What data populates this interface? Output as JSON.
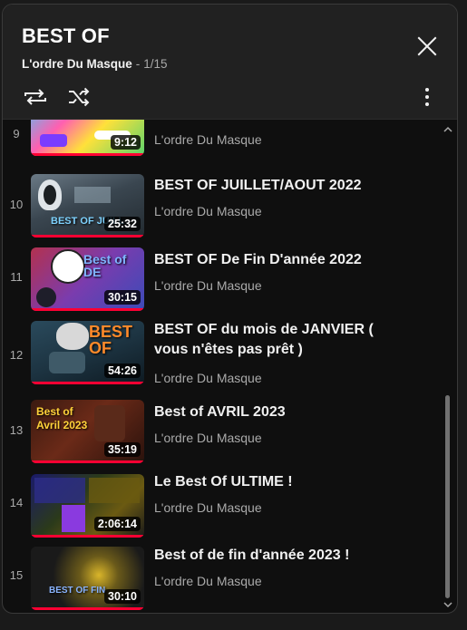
{
  "header": {
    "title": "BEST OF",
    "channel": "L'ordre Du Masque",
    "separator": "-",
    "position": "1/15"
  },
  "icons": {
    "close": "close-icon",
    "loop": "loop-icon",
    "shuffle": "shuffle-icon",
    "more": "more-vert-icon"
  },
  "colors": {
    "progress": "#ff0033",
    "background": "#0f0f0f",
    "header_bg": "#212121"
  },
  "items": [
    {
      "index": "9",
      "title": "",
      "channel": "L'ordre Du Masque",
      "duration": "9:12",
      "thumb_text": ""
    },
    {
      "index": "10",
      "title": "BEST OF JUILLET/AOUT 2022",
      "channel": "L'ordre Du Masque",
      "duration": "25:32",
      "thumb_text": "BEST OF JUILL"
    },
    {
      "index": "11",
      "title": "BEST OF De Fin D'année 2022",
      "channel": "L'ordre Du Masque",
      "duration": "30:15",
      "thumb_text": "Best of DE"
    },
    {
      "index": "12",
      "title": "BEST OF du mois de JANVIER ( vous n'êtes pas prêt )",
      "channel": "L'ordre Du Masque",
      "duration": "54:26",
      "thumb_text": "BEST OF"
    },
    {
      "index": "13",
      "title": "Best of AVRIL 2023",
      "channel": "L'ordre Du Masque",
      "duration": "35:19",
      "thumb_text": "Best of Avril 2023"
    },
    {
      "index": "14",
      "title": "Le Best Of ULTIME !",
      "channel": "L'ordre Du Masque",
      "duration": "2:06:14",
      "thumb_text": ""
    },
    {
      "index": "15",
      "title": "Best of de fin d'année 2023 !",
      "channel": "L'ordre Du Masque",
      "duration": "30:10",
      "thumb_text": "BEST OF FIN"
    }
  ]
}
